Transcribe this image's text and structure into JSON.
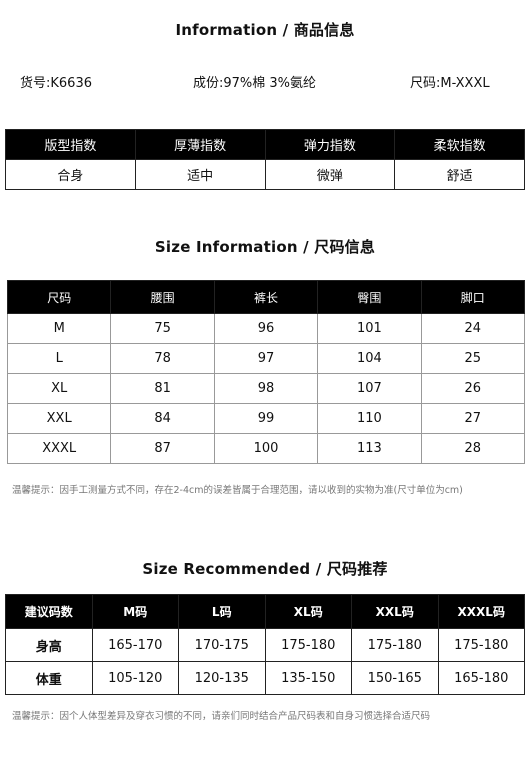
{
  "section1": {
    "title": "Information / 商品信息",
    "item_no": "货号:K6636",
    "composition": "成份:97%棉  3%氨纶",
    "size_range": "尺码:M-XXXL",
    "headers": [
      "版型指数",
      "厚薄指数",
      "弹力指数",
      "柔软指数"
    ],
    "values": [
      "合身",
      "适中",
      "微弹",
      "舒适"
    ]
  },
  "section2": {
    "title": "Size Information  / 尺码信息",
    "headers": [
      "尺码",
      "腰围",
      "裤长",
      "臀围",
      "脚口"
    ],
    "rows": [
      [
        "M",
        "75",
        "96",
        "101",
        "24"
      ],
      [
        "L",
        "78",
        "97",
        "104",
        "25"
      ],
      [
        "XL",
        "81",
        "98",
        "107",
        "26"
      ],
      [
        "XXL",
        "84",
        "99",
        "110",
        "27"
      ],
      [
        "XXXL",
        "87",
        "100",
        "113",
        "28"
      ]
    ],
    "note": "温馨提示：因手工测量方式不同，存在2-4cm的误差皆属于合理范围，请以收到的实物为准(尺寸单位为cm)"
  },
  "section3": {
    "title": "Size Recommended  / 尺码推荐",
    "headers": [
      "建议码数",
      "M码",
      "L码",
      "XL码",
      "XXL码",
      "XXXL码"
    ],
    "rows": [
      [
        "身高",
        "165-170",
        "170-175",
        "175-180",
        "175-180",
        "175-180"
      ],
      [
        "体重",
        "105-120",
        "120-135",
        "135-150",
        "150-165",
        "165-180"
      ]
    ],
    "note": "温馨提示：因个人体型差异及穿衣习惯的不同，请亲们同时结合产品尺码表和自身习惯选择合适尺码"
  }
}
